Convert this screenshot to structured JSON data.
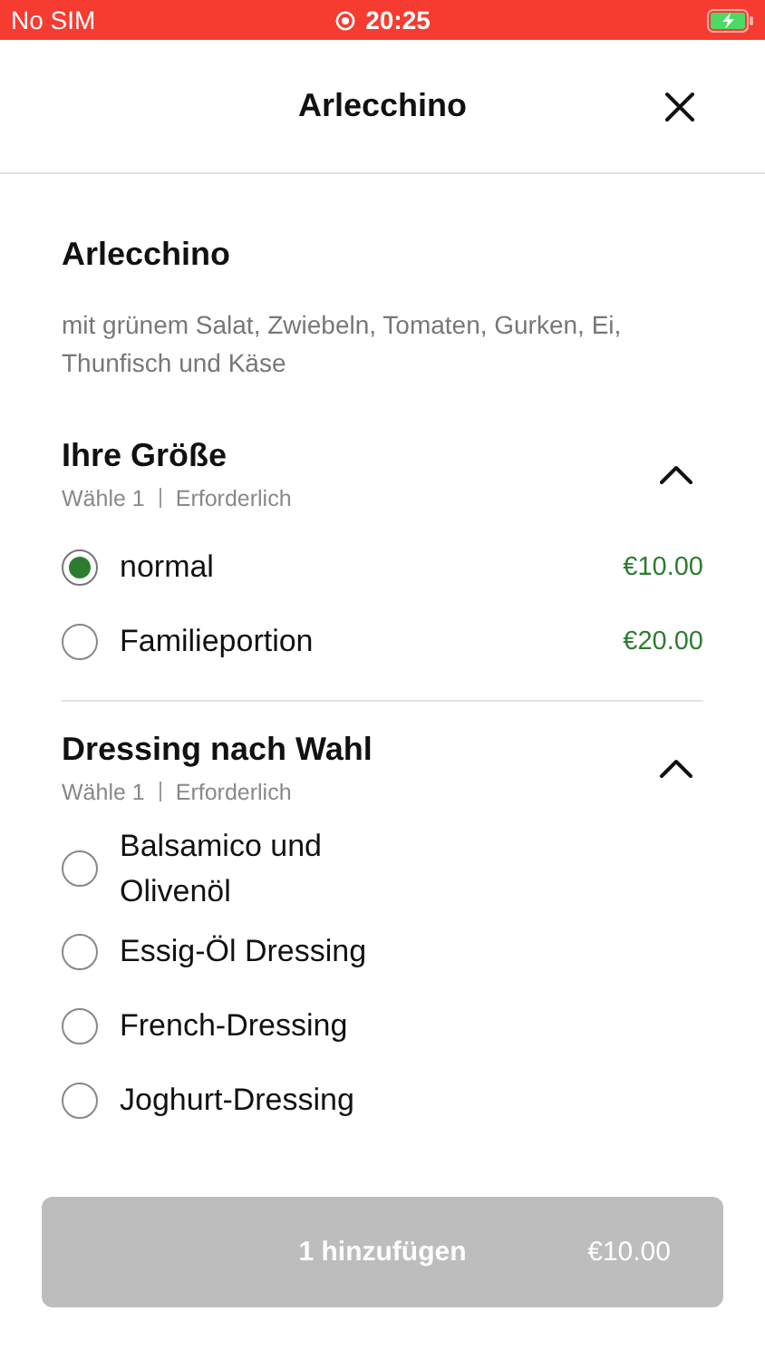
{
  "status_bar": {
    "carrier": "No SIM",
    "time": "20:25",
    "charging": true
  },
  "header": {
    "title": "Arlecchino"
  },
  "product": {
    "name": "Arlecchino",
    "description": "mit grünem Salat, Zwiebeln, Tomaten, Gurken, Ei, Thunfisch und Käse"
  },
  "sections": [
    {
      "title": "Ihre Größe",
      "choose": "Wähle 1",
      "requirement": "Erforderlich",
      "expanded": true,
      "options": [
        {
          "label": "normal",
          "price": "€10.00",
          "selected": true
        },
        {
          "label": "Familieportion",
          "price": "€20.00",
          "selected": false
        }
      ]
    },
    {
      "title": "Dressing nach Wahl",
      "choose": "Wähle 1",
      "requirement": "Erforderlich",
      "expanded": true,
      "options": [
        {
          "label": "Balsamico und Olivenöl",
          "selected": false
        },
        {
          "label": "Essig-Öl Dressing",
          "selected": false
        },
        {
          "label": "French-Dressing",
          "selected": false
        },
        {
          "label": "Joghurt-Dressing",
          "selected": false
        }
      ]
    }
  ],
  "add_button": {
    "label": "1 hinzufügen",
    "price": "€10.00",
    "disabled": true
  }
}
